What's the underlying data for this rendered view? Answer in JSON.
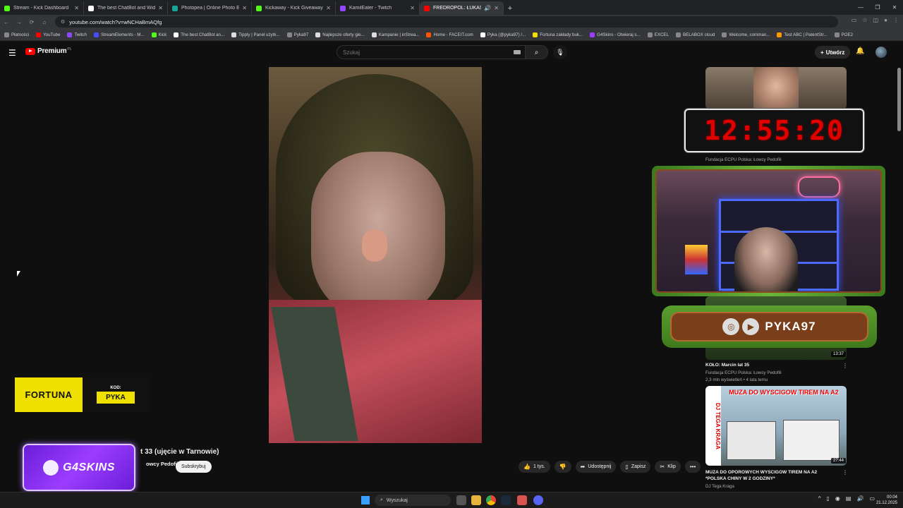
{
  "browser": {
    "tabs": [
      {
        "title": "Stream - Kick Dashboard",
        "color": "#53fc18"
      },
      {
        "title": "The best ChatBot and Widgets",
        "color": "#ffffff"
      },
      {
        "title": "Photopea | Online Photo Editor",
        "color": "#18a497"
      },
      {
        "title": "Kickaway - Kick Giveaway Tool",
        "color": "#53fc18"
      },
      {
        "title": "KamilEater - Twitch",
        "color": "#9146ff"
      },
      {
        "title": "FREDROPOL: ŁUKASZ S. lat",
        "color": "#ff0000"
      }
    ],
    "url": "youtube.com/watch?v=wNCHaBmAQfg",
    "bookmarks": [
      {
        "label": "Płatności",
        "color": "#888888"
      },
      {
        "label": "YouTube",
        "color": "#ff0000"
      },
      {
        "label": "Twitch",
        "color": "#9146ff"
      },
      {
        "label": "StreamElements - M...",
        "color": "#4a4aff"
      },
      {
        "label": "Kick",
        "color": "#53fc18"
      },
      {
        "label": "The best ChatBot an...",
        "color": "#ffffff"
      },
      {
        "label": "Tipply | Panel użytk...",
        "color": "#dddddd"
      },
      {
        "label": "Pyka97",
        "color": "#888888"
      },
      {
        "label": "Najlepsze oferty gie...",
        "color": "#dddddd"
      },
      {
        "label": "Kampanie | inStrea...",
        "color": "#dddddd"
      },
      {
        "label": "Home - FACEIT.com",
        "color": "#ff5500"
      },
      {
        "label": "Pyka (@pyka97) /...",
        "color": "#ffffff"
      },
      {
        "label": "Fortuna zakłady buk...",
        "color": "#f0e000"
      },
      {
        "label": "G4Skins - Otwieraj s...",
        "color": "#9b3cff"
      },
      {
        "label": "EXCEL",
        "color": "#888888"
      },
      {
        "label": "BELABOX cloud",
        "color": "#888888"
      },
      {
        "label": "Welcome, comman...",
        "color": "#888888"
      },
      {
        "label": "Test ABC | PatentStr...",
        "color": "#ff9900"
      },
      {
        "label": "POE2",
        "color": "#888888"
      }
    ]
  },
  "youtube": {
    "logo_word": "Premium",
    "logo_cc": "PL",
    "search_placeholder": "Szukaj",
    "create_label": "Utwórz",
    "video_title": "t 33 (ujęcie w Tarnowie)",
    "channel_name": "owcy Pedofili",
    "subscribe_label": "Subskrybuj",
    "actions": {
      "like": "1 tys.",
      "share": "Udostępnij",
      "save": "Zapisz",
      "clip": "Klip"
    }
  },
  "sidebar": [
    {
      "channel": "Fundacja ECPU Polska: Łowcy Pedofili"
    },
    {
      "title": "KOŁO: Marcin lat 35",
      "channel": "Fundacja ECPU Polska: Łowcy Pedofili",
      "meta": "2,3 mln wyświetleń • 4 lata temu",
      "duration": "13:37"
    },
    {
      "title": "MUZA DO OPOROWYCH WYSCIGOW TIREM NA A2 *POLSKA CHINY W 2 GODZINY*",
      "channel": "DJ Tega Kraga",
      "duration": "27:44",
      "thumb_text": "MUZA DO WYSCIGOW TIREM NA A2",
      "thumb_side": "DJ TEGA KRAGA"
    }
  ],
  "overlays": {
    "timer": "12:55:20",
    "social_handle": "PYKA97",
    "fortuna_brand": "FORTUNA",
    "fortuna_kod": "KOD:",
    "fortuna_code": "PYKA",
    "g4_brand": "G4SKINS"
  },
  "taskbar": {
    "search_label": "Wyszukaj",
    "time": "00:04",
    "date": "21.12.2025"
  }
}
